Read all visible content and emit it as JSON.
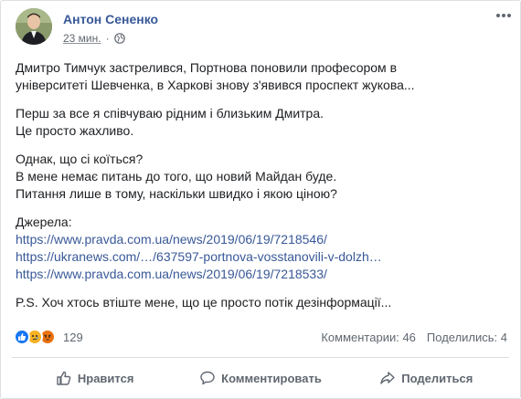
{
  "post": {
    "author": "Антон Сененко",
    "time": "23 мин.",
    "separator": "·",
    "privacy_icon": "globe-icon",
    "paragraphs": [
      {
        "lines": [
          "Дмитро Тимчук застрелився, Портнова поновили професором в",
          "університеті Шевченка, в Харкові знову з'явився проспект жукова..."
        ]
      },
      {
        "lines": [
          "Перш за все я співчуваю рідним і близьким Дмитра.",
          "Це просто жахливо."
        ]
      },
      {
        "lines": [
          "Однак, що сі коїться?",
          "В мене немає питань до того, що новий Майдан буде.",
          "Питання лише в тому, наскільки швидко і якою ціною?"
        ]
      }
    ],
    "sources_label": "Джерела:",
    "links": [
      "https://www.pravda.com.ua/news/2019/06/19/7218546/",
      "https://ukranews.com/…/637597-portnova-vosstanovili-v-dolzh…",
      "https://www.pravda.com.ua/news/2019/06/19/7218533/"
    ],
    "ps": "P.S. Хоч хтось втіште мене, що це просто потік дезінформації..."
  },
  "stats": {
    "reaction_icons": [
      "like-icon",
      "sad-icon",
      "angry-icon"
    ],
    "reactions_count": "129",
    "comments": "Комментарии: 46",
    "shares": "Поделились: 4"
  },
  "actions": {
    "like": "Нравится",
    "comment": "Комментировать",
    "share": "Поделиться"
  },
  "colors": {
    "link": "#385898",
    "like": "#1877f2",
    "muted": "#606770"
  }
}
